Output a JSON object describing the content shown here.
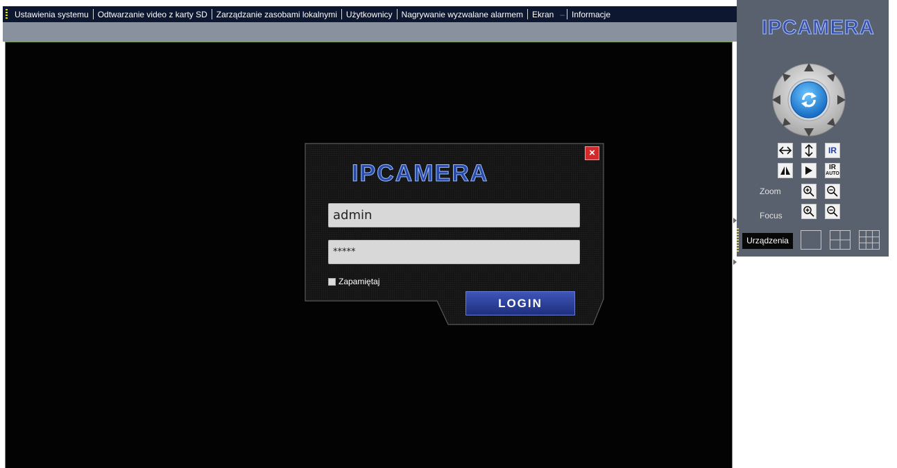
{
  "menu": {
    "items": [
      "Ustawienia systemu",
      "Odtwarzanie video z karty SD",
      "Zarządzanie zasobami lokalnymi",
      "Użytkownicy",
      "Nagrywanie wyzwalane alarmem",
      "Ekran",
      "Informacje"
    ]
  },
  "login": {
    "logo": "IPCAMERA",
    "close": "×",
    "username": "admin",
    "password": "*****",
    "remember": "Zapamiętaj",
    "button": "LOGIN"
  },
  "panel": {
    "logo": "IPCAMERA",
    "zoom": "Zoom",
    "focus": "Focus",
    "ir": "IR",
    "ir_auto_top": "IR",
    "ir_auto_bottom": "AUTO",
    "devices": "Urządzenia"
  },
  "colors": {
    "menubar": "#0d1730",
    "panel": "#59616e",
    "video": "#030303",
    "accent_blue": "#2a4aa8",
    "close_red": "#d22a2a"
  }
}
